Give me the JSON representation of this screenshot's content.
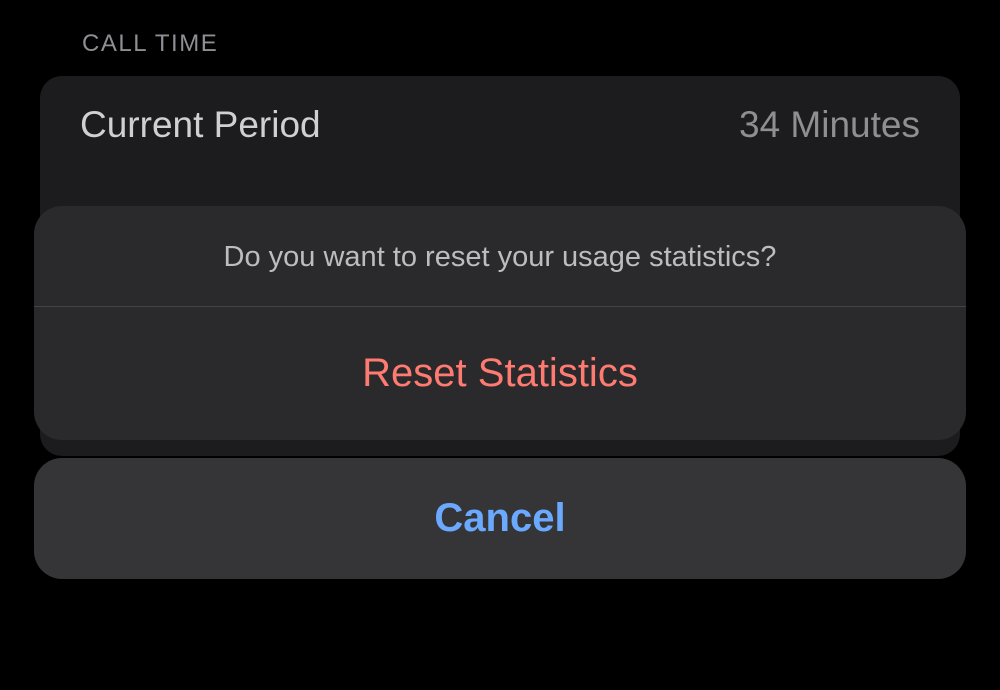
{
  "section": {
    "header": "CALL TIME",
    "rows": [
      {
        "label": "Current Period",
        "value": "34 Minutes"
      }
    ]
  },
  "sheet": {
    "message": "Do you want to reset your usage statistics?",
    "destructive_label": "Reset Statistics",
    "cancel_label": "Cancel"
  }
}
